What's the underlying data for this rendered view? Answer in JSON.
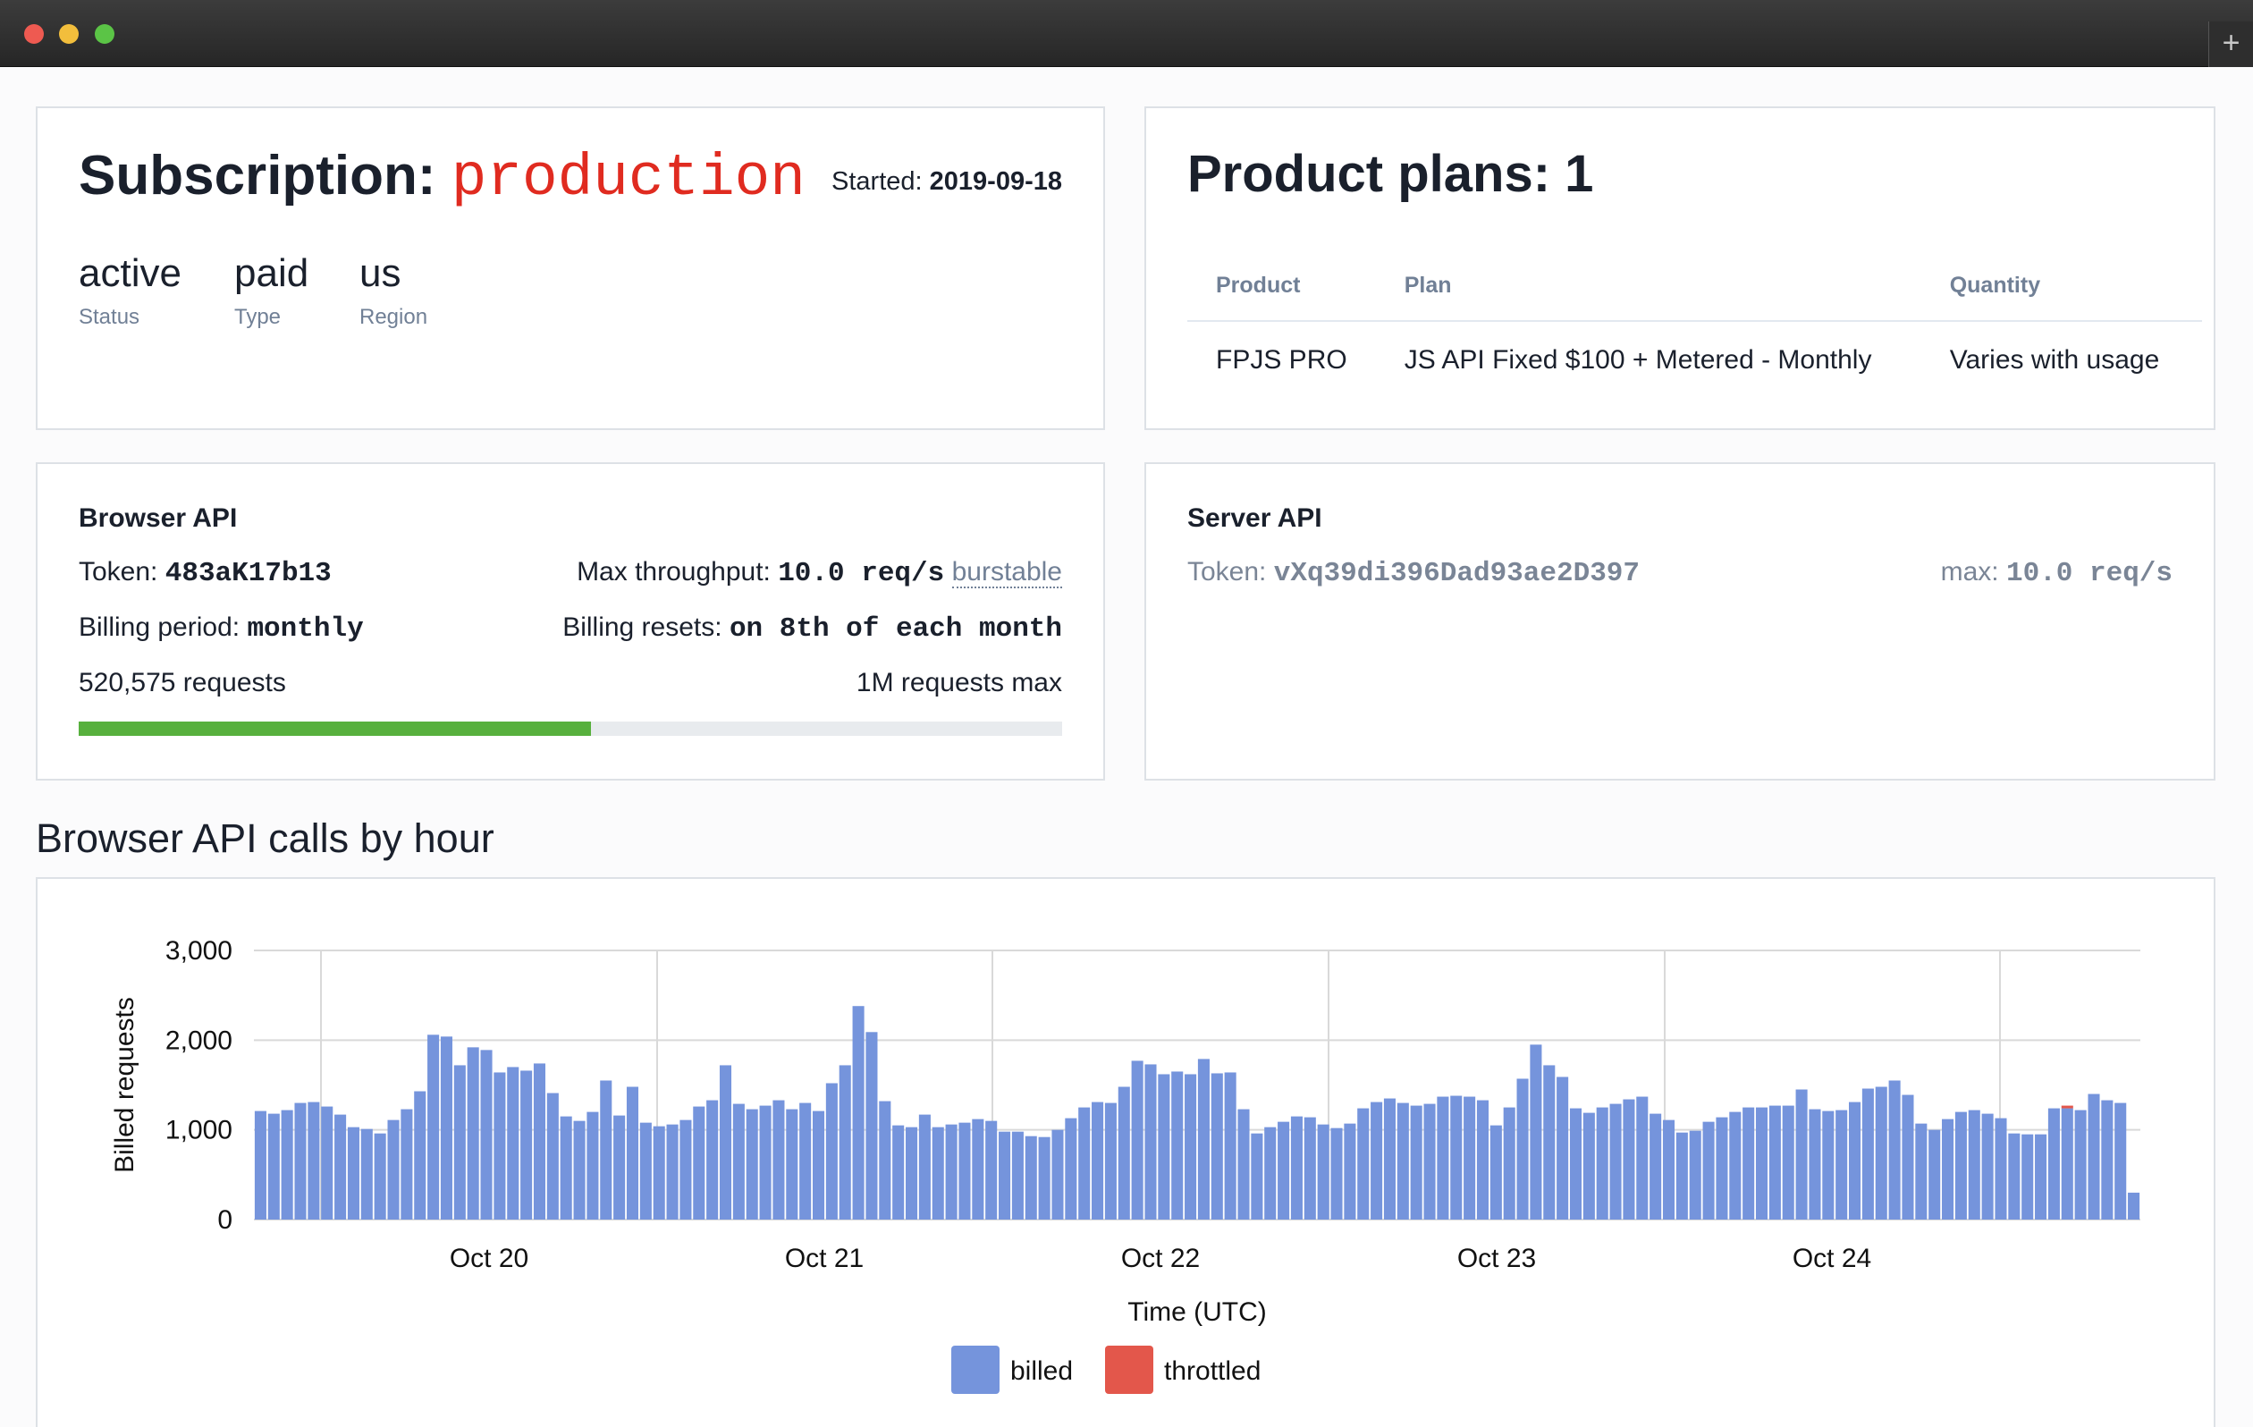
{
  "window": {
    "new_tab_label": "+"
  },
  "subscription": {
    "label": "Subscription:",
    "name": "production",
    "started_label": "Started:",
    "started_date": "2019-09-18",
    "stats": [
      {
        "value": "active",
        "label": "Status"
      },
      {
        "value": "paid",
        "label": "Type"
      },
      {
        "value": "us",
        "label": "Region"
      }
    ]
  },
  "plans": {
    "title": "Product plans:",
    "count": "1",
    "headers": [
      "Product",
      "Plan",
      "Quantity"
    ],
    "rows": [
      [
        "FPJS PRO",
        "JS API Fixed $100 + Metered - Monthly",
        "Varies with usage"
      ]
    ]
  },
  "browser_api": {
    "title": "Browser API",
    "token_label": "Token:",
    "token": "483aK17b13",
    "throughput_label": "Max throughput:",
    "throughput": "10.0 req/s",
    "burstable": "burstable",
    "billing_period_label": "Billing period:",
    "billing_period": "monthly",
    "billing_resets_label": "Billing resets:",
    "billing_resets": "on 8th of each month",
    "requests": "520,575 requests",
    "requests_max": "1M requests max",
    "usage_fraction": 0.5206,
    "bar_color": "#57b03d"
  },
  "server_api": {
    "title": "Server API",
    "token_label": "Token:",
    "token": "vXq39di396Dad93ae2D397",
    "max_label": "max:",
    "max": "10.0 req/s"
  },
  "chart_heading": "Browser API calls by hour",
  "chart_data": {
    "type": "bar",
    "stacked": true,
    "xlabel": "Time (UTC)",
    "ylabel": "Billed requests",
    "ylim": [
      0,
      3000
    ],
    "yticks": [
      "0",
      "1,000",
      "2,000",
      "3,000"
    ],
    "xticks": [
      "Oct 20",
      "Oct 21",
      "Oct 22",
      "Oct 23",
      "Oct 24"
    ],
    "grid": true,
    "legend_position": "bottom-center",
    "colors": {
      "billed": "#7594dc",
      "throttled": "#e3574b"
    },
    "series": [
      {
        "name": "billed",
        "values": [
          1210,
          1180,
          1220,
          1300,
          1310,
          1260,
          1170,
          1030,
          1010,
          960,
          1110,
          1230,
          1430,
          2060,
          2040,
          1720,
          1920,
          1890,
          1640,
          1700,
          1660,
          1740,
          1410,
          1150,
          1100,
          1200,
          1550,
          1160,
          1480,
          1080,
          1040,
          1060,
          1110,
          1260,
          1330,
          1720,
          1290,
          1230,
          1270,
          1330,
          1230,
          1300,
          1210,
          1520,
          1720,
          2380,
          2090,
          1320,
          1050,
          1030,
          1170,
          1030,
          1060,
          1080,
          1120,
          1100,
          980,
          980,
          930,
          920,
          1000,
          1130,
          1250,
          1310,
          1300,
          1480,
          1770,
          1730,
          1620,
          1650,
          1620,
          1790,
          1630,
          1640,
          1230,
          960,
          1030,
          1090,
          1150,
          1140,
          1060,
          1020,
          1070,
          1240,
          1310,
          1350,
          1300,
          1270,
          1290,
          1370,
          1380,
          1370,
          1330,
          1050,
          1250,
          1570,
          1950,
          1720,
          1590,
          1240,
          1190,
          1250,
          1290,
          1340,
          1370,
          1180,
          1110,
          970,
          990,
          1090,
          1140,
          1200,
          1250,
          1250,
          1270,
          1270,
          1450,
          1230,
          1210,
          1220,
          1310,
          1460,
          1480,
          1550,
          1390,
          1070,
          1000,
          1120,
          1200,
          1220,
          1180,
          1130,
          960,
          950,
          950,
          1240,
          1240,
          1220,
          1400,
          1330,
          1300,
          300
        ]
      },
      {
        "name": "throttled",
        "values": [
          0,
          0,
          0,
          0,
          0,
          0,
          0,
          0,
          0,
          0,
          0,
          0,
          0,
          0,
          0,
          0,
          0,
          0,
          0,
          0,
          0,
          0,
          0,
          0,
          0,
          0,
          0,
          0,
          0,
          0,
          0,
          0,
          0,
          0,
          0,
          0,
          0,
          0,
          0,
          0,
          0,
          0,
          0,
          0,
          0,
          0,
          0,
          0,
          0,
          0,
          0,
          0,
          0,
          0,
          0,
          0,
          0,
          0,
          0,
          0,
          0,
          0,
          0,
          0,
          0,
          0,
          0,
          0,
          0,
          0,
          0,
          0,
          0,
          0,
          0,
          0,
          0,
          0,
          0,
          0,
          0,
          0,
          0,
          0,
          0,
          0,
          0,
          0,
          0,
          0,
          0,
          0,
          0,
          0,
          0,
          0,
          0,
          0,
          0,
          0,
          0,
          0,
          0,
          0,
          0,
          0,
          0,
          0,
          0,
          0,
          0,
          0,
          0,
          0,
          0,
          0,
          0,
          0,
          0,
          0,
          0,
          0,
          0,
          0,
          0,
          0,
          0,
          0,
          0,
          0,
          0,
          0,
          0,
          0,
          0,
          0,
          30,
          0,
          0,
          0,
          0,
          0,
          0
        ]
      }
    ]
  }
}
